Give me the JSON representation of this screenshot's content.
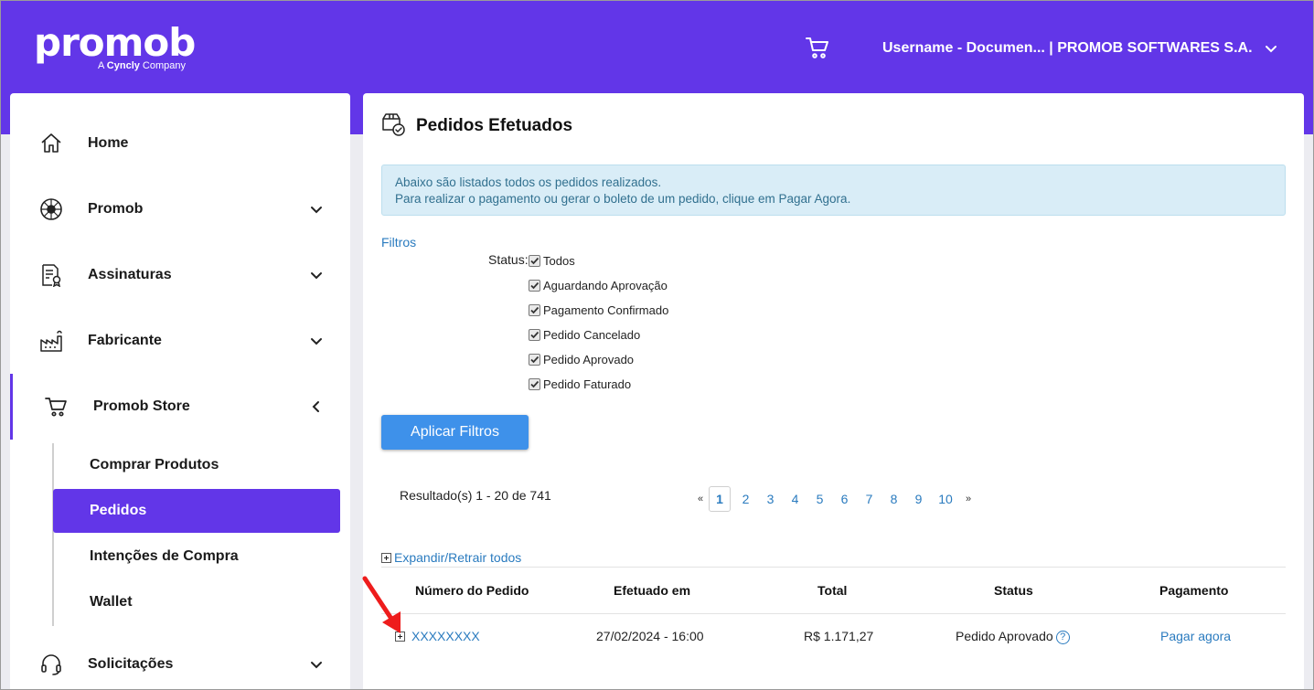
{
  "header": {
    "logo_text": "promob",
    "logo_sub_prefix": "A ",
    "logo_sub_brand": "Cyncly",
    "logo_sub_suffix": " Company",
    "user_label": "Username - Documen... | PROMOB SOFTWARES S.A.",
    "cart_icon": "cart-icon",
    "brand_color": "#6236e8"
  },
  "sidebar": {
    "items": [
      {
        "label": "Home",
        "icon": "home-icon"
      },
      {
        "label": "Promob",
        "icon": "promob-icon"
      },
      {
        "label": "Assinaturas",
        "icon": "subscription-icon"
      },
      {
        "label": "Fabricante",
        "icon": "factory-icon"
      },
      {
        "label": "Promob Store",
        "icon": "cart-icon"
      },
      {
        "label": "Solicitações",
        "icon": "headset-icon"
      }
    ],
    "sub_items": [
      {
        "label": "Comprar Produtos"
      },
      {
        "label": "Pedidos"
      },
      {
        "label": "Intenções de Compra"
      },
      {
        "label": "Wallet"
      }
    ]
  },
  "main": {
    "title": "Pedidos Efetuados",
    "alert_line1": "Abaixo são listados todos os pedidos realizados.",
    "alert_line2": "Para realizar o pagamento ou gerar o boleto de um pedido, clique em Pagar Agora.",
    "filters_label": "Filtros",
    "status_label": "Status:",
    "statuses": [
      {
        "label": "Todos",
        "checked": true
      },
      {
        "label": "Aguardando Aprovação",
        "checked": true
      },
      {
        "label": "Pagamento Confirmado",
        "checked": true
      },
      {
        "label": "Pedido Cancelado",
        "checked": true
      },
      {
        "label": "Pedido Aprovado",
        "checked": true
      },
      {
        "label": "Pedido Faturado",
        "checked": true
      }
    ],
    "apply_button": "Aplicar Filtros",
    "results_text": "Resultado(s) 1 - 20 de 741",
    "pagination": {
      "prev": "«",
      "next": "»",
      "current": "1",
      "pages": [
        "2",
        "3",
        "4",
        "5",
        "6",
        "7",
        "8",
        "9",
        "10"
      ]
    },
    "expand_label": "Expandir/Retrair todos",
    "table": {
      "headers": [
        "Número do Pedido",
        "Efetuado em",
        "Total",
        "Status",
        "Pagamento"
      ],
      "rows": [
        {
          "order_number": "XXXXXXXX",
          "date": "27/02/2024 - 16:00",
          "total": "R$ 1.171,27",
          "status": "Pedido Aprovado",
          "help": "?",
          "payment": "Pagar agora"
        }
      ]
    }
  }
}
